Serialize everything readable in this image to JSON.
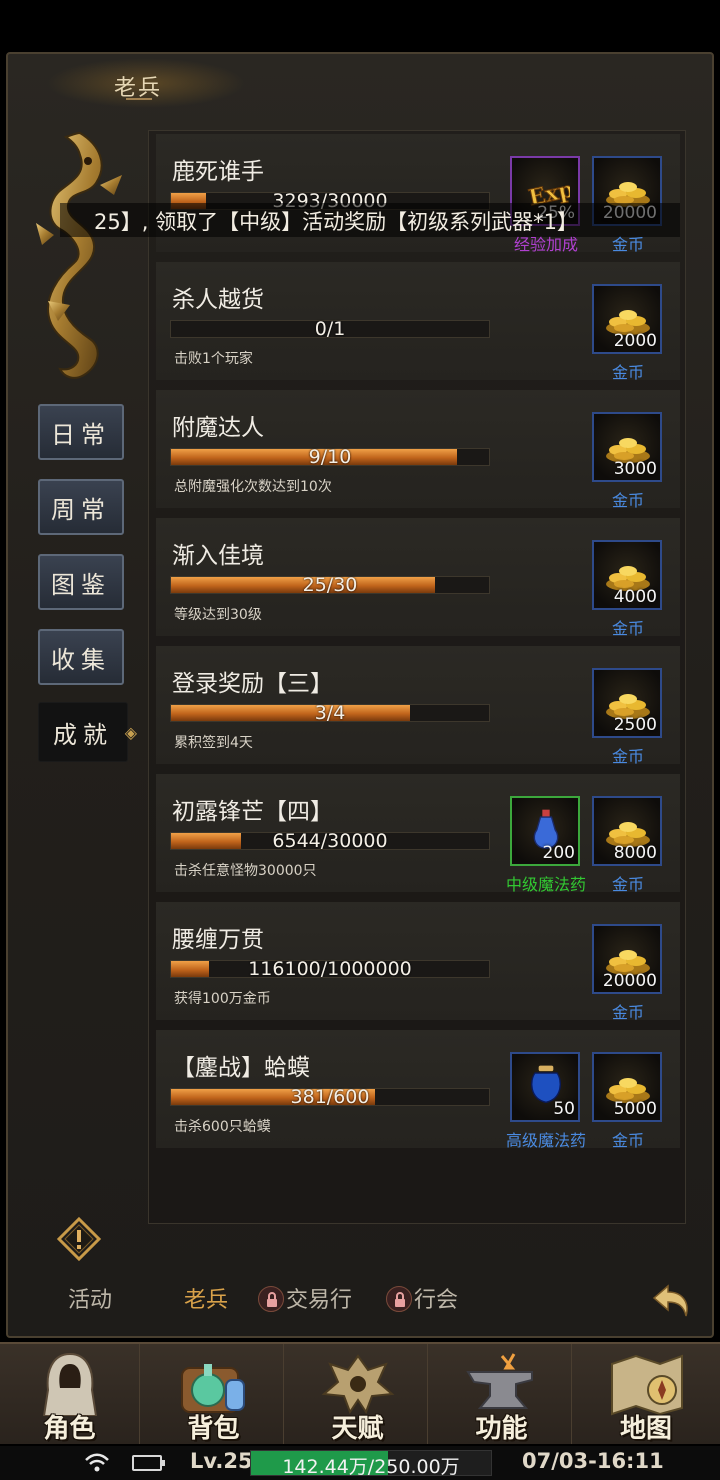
{
  "header": {
    "title": "老兵"
  },
  "side_tabs": [
    {
      "label": "日常"
    },
    {
      "label": "周常"
    },
    {
      "label": "图鉴"
    },
    {
      "label": "收集"
    },
    {
      "label": "成就",
      "active": true
    }
  ],
  "marquee": {
    "text": "25】, 领取了【中级】活动奖励【初级系列武器*1】"
  },
  "achievements": [
    {
      "title": "鹿死谁手",
      "progress_text": "3293/30000",
      "progress": 0.11,
      "desc": "",
      "rewards": [
        {
          "type": "exp",
          "count": "25%",
          "label": "经验加成",
          "label_color": "purple"
        },
        {
          "type": "gold",
          "count": "20000",
          "label": "金币",
          "label_color": "gold"
        }
      ]
    },
    {
      "title": "杀人越货",
      "progress_text": "0/1",
      "progress": 0.0,
      "desc": "击败1个玩家",
      "rewards": [
        {
          "type": "gold",
          "count": "2000",
          "label": "金币",
          "label_color": "gold"
        }
      ]
    },
    {
      "title": "附魔达人",
      "progress_text": "9/10",
      "progress": 0.9,
      "desc": "总附魔强化次数达到10次",
      "rewards": [
        {
          "type": "gold",
          "count": "3000",
          "label": "金币",
          "label_color": "gold"
        }
      ]
    },
    {
      "title": "渐入佳境",
      "progress_text": "25/30",
      "progress": 0.83,
      "desc": "等级达到30级",
      "rewards": [
        {
          "type": "gold",
          "count": "4000",
          "label": "金币",
          "label_color": "gold"
        }
      ]
    },
    {
      "title": "登录奖励【三】",
      "progress_text": "3/4",
      "progress": 0.75,
      "desc": "累积签到4天",
      "rewards": [
        {
          "type": "gold",
          "count": "2500",
          "label": "金币",
          "label_color": "gold"
        }
      ]
    },
    {
      "title": "初露锋芒【四】",
      "progress_text": "6544/30000",
      "progress": 0.22,
      "desc": "击杀任意怪物30000只",
      "rewards": [
        {
          "type": "potion-mid",
          "count": "200",
          "label": "中级魔法药",
          "label_color": "green"
        },
        {
          "type": "gold",
          "count": "8000",
          "label": "金币",
          "label_color": "gold"
        }
      ]
    },
    {
      "title": "腰缠万贯",
      "progress_text": "116100/1000000",
      "progress": 0.12,
      "desc": "获得100万金币",
      "rewards": [
        {
          "type": "gold",
          "count": "20000",
          "label": "金币",
          "label_color": "gold"
        }
      ]
    },
    {
      "title": "【鏖战】蛤蟆",
      "progress_text": "381/600",
      "progress": 0.64,
      "desc": "击杀600只蛤蟆",
      "rewards": [
        {
          "type": "potion-high",
          "count": "50",
          "label": "高级魔法药",
          "label_color": "blue"
        },
        {
          "type": "gold",
          "count": "5000",
          "label": "金币",
          "label_color": "gold"
        }
      ]
    }
  ],
  "bottom_tabs": [
    {
      "label": "活动",
      "locked": false
    },
    {
      "label": "老兵",
      "locked": false,
      "active": true
    },
    {
      "label": "交易行",
      "locked": true
    },
    {
      "label": "行会",
      "locked": true
    }
  ],
  "nav": [
    {
      "label": "角色",
      "icon": "character-icon"
    },
    {
      "label": "背包",
      "icon": "bag-icon"
    },
    {
      "label": "天赋",
      "icon": "talent-icon"
    },
    {
      "label": "功能",
      "icon": "anvil-icon"
    },
    {
      "label": "地图",
      "icon": "map-icon"
    }
  ],
  "status": {
    "level": "Lv.25",
    "exp_text": "142.44万/250.00万",
    "exp_progress": 0.57,
    "clock": "07/03-16:11"
  },
  "colors": {
    "accent": "#d9a24a",
    "gold_label": "#4a8ae0",
    "green_label": "#32c832",
    "purple_label": "#b040d0"
  }
}
